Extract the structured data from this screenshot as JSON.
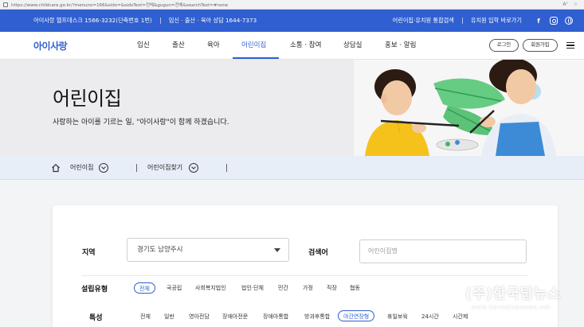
{
  "browser": {
    "url": "https://www.childcare.go.kr/?menuno=166&sido=&sidoText=전체&gugun=전체&searchText=#none"
  },
  "topbar": {
    "helpdesk": "아이사랑 헬프데스크 1566-3232(단축번호 1번)",
    "counsel": "임신 · 출산 · 육아 상담 1644-7373",
    "integrated_search": "어린이집·유치원 통합검색",
    "kindergarten_link": "유치원 입학 바로가기"
  },
  "nav": {
    "logo": "아이사랑",
    "items": [
      "임신",
      "출산",
      "육아",
      "어린이집",
      "소통 · 참여",
      "상담실",
      "홍보 · 알림"
    ],
    "login": "로그인",
    "signup": "회원가입"
  },
  "hero": {
    "title": "어린이집",
    "subtitle": "사랑하는 아이를 기르는 일, \"아이사랑\"이 함께 하겠습니다."
  },
  "breadcrumb": {
    "level1": "어린이집",
    "level2": "어린이집찾기"
  },
  "search": {
    "region_label": "지역",
    "region_value": "경기도 남양주시",
    "keyword_label": "검색어",
    "keyword_placeholder": "어린이집명",
    "type_label": "설립유형",
    "types": [
      "전체",
      "국공립",
      "사회복지법인",
      "법인·단체",
      "민간",
      "가정",
      "직장",
      "협동"
    ],
    "feature_label": "특성",
    "features": [
      "전체",
      "일반",
      "영아전담",
      "장애아전문",
      "장애아통합",
      "방과후통합",
      "야간연장형",
      "휴일보육",
      "24시간",
      "시간제"
    ]
  },
  "watermark": {
    "main": "(주)한국탑뉴스",
    "sub": "www.koreatopnews.net"
  },
  "colors": {
    "brand_blue": "#2f5fd0",
    "hero_bg": "#ececee",
    "crumb_bg": "#e8eef8"
  }
}
